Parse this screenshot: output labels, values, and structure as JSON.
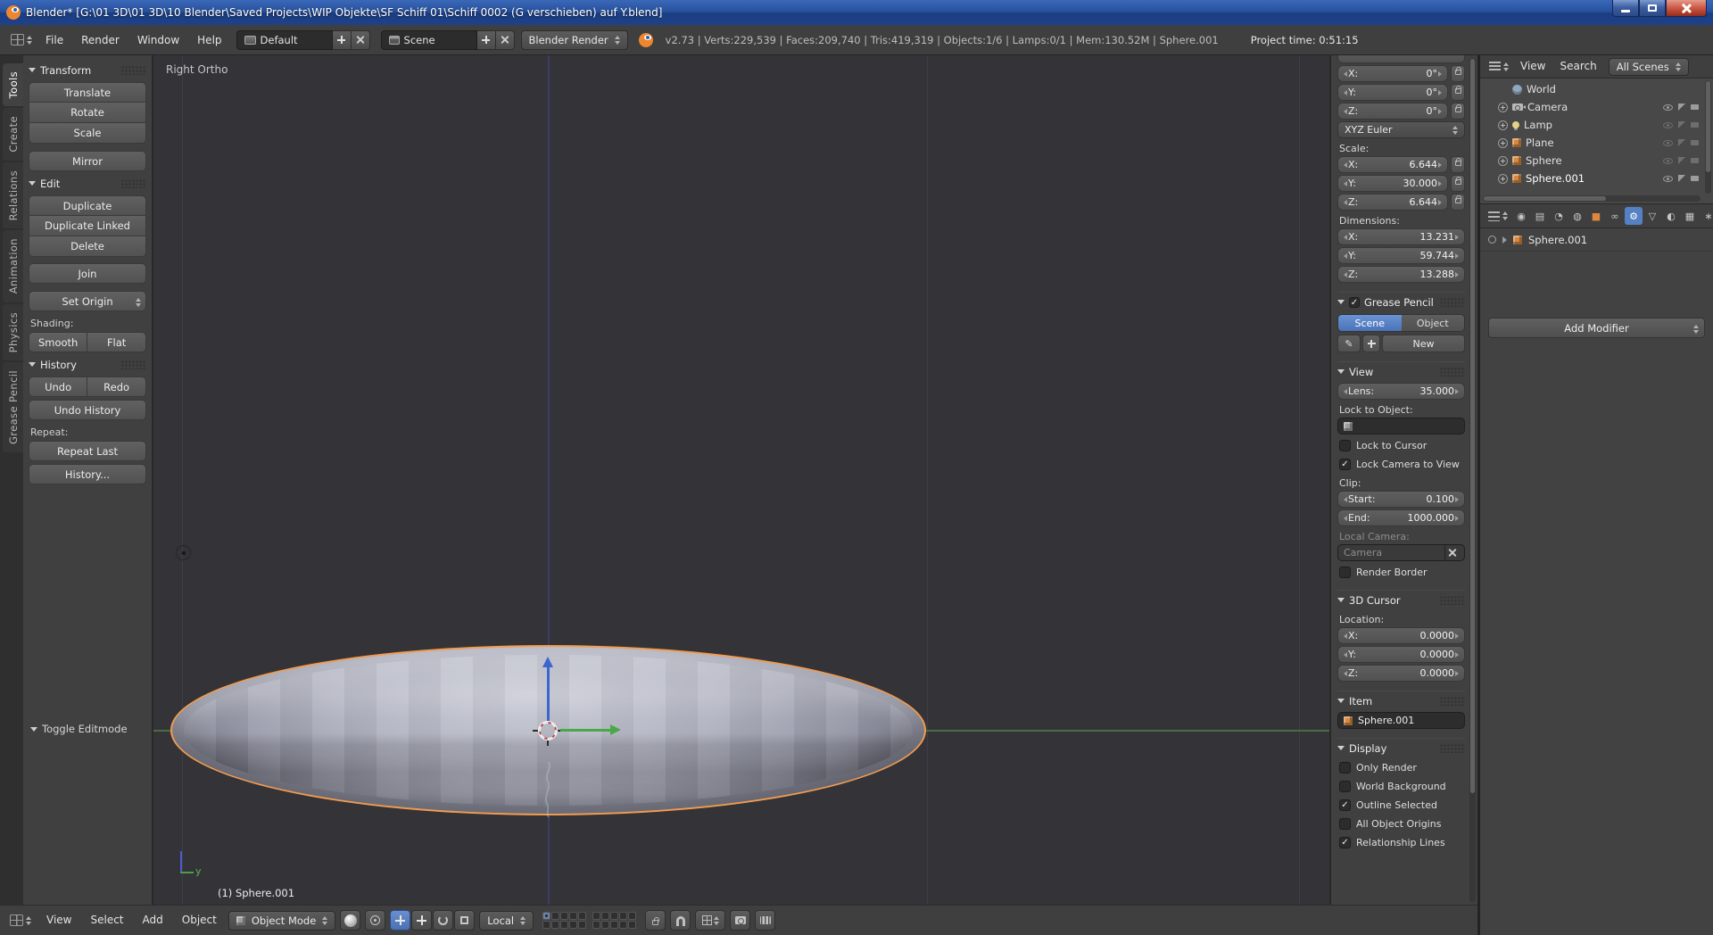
{
  "titlebar": {
    "title": "Blender* [G:\\01 3D\\01 3D\\10 Blender\\Saved Projects\\WIP Objekte\\SF Schiff 01\\Schiff 0002 (G verschieben) auf Y.blend]"
  },
  "topbar": {
    "menus": [
      "File",
      "Render",
      "Window",
      "Help"
    ],
    "layout": "Default",
    "scene": "Scene",
    "engine": "Blender Render",
    "stats": "v2.73 | Verts:229,539 | Faces:209,740 | Tris:419,319 | Objects:1/6 | Lamps:0/1 | Mem:130.52M | Sphere.001",
    "project_time": "Project time: 0:51:15"
  },
  "toolshelf": {
    "tabs": [
      "Tools",
      "Create",
      "Relations",
      "Animation",
      "Physics",
      "Grease Pencil"
    ],
    "transform": {
      "title": "Transform",
      "translate": "Translate",
      "rotate": "Rotate",
      "scale": "Scale",
      "mirror": "Mirror"
    },
    "edit": {
      "title": "Edit",
      "duplicate": "Duplicate",
      "duplicate_linked": "Duplicate Linked",
      "delete": "Delete",
      "join": "Join",
      "set_origin": "Set Origin",
      "shading_label": "Shading:",
      "smooth": "Smooth",
      "flat": "Flat"
    },
    "history": {
      "title": "History",
      "undo": "Undo",
      "redo": "Redo",
      "undo_history": "Undo History",
      "repeat_label": "Repeat:",
      "repeat_last": "Repeat Last",
      "history_item": "History..."
    },
    "redo_panel": "Toggle Editmode"
  },
  "viewport": {
    "view_label": "Right Ortho",
    "object_label": "(1) Sphere.001",
    "axis_y": "y",
    "header": {
      "menus": [
        "View",
        "Select",
        "Add",
        "Object"
      ],
      "mode": "Object Mode",
      "orientation": "Local"
    }
  },
  "npanel": {
    "rotation": {
      "x_label": "X:",
      "x_value": "0°",
      "y_label": "Y:",
      "y_value": "0°",
      "z_label": "Z:",
      "z_value": "0°",
      "mode": "XYZ Euler"
    },
    "scale": {
      "label": "Scale:",
      "x_label": "X:",
      "x_value": "6.644",
      "y_label": "Y:",
      "y_value": "30.000",
      "z_label": "Z:",
      "z_value": "6.644"
    },
    "dimensions": {
      "label": "Dimensions:",
      "x_label": "X:",
      "x_value": "13.231",
      "y_label": "Y:",
      "y_value": "59.744",
      "z_label": "Z:",
      "z_value": "13.288"
    },
    "grease_pencil": {
      "title": "Grease Pencil",
      "scene": "Scene",
      "object": "Object",
      "new_btn": "New"
    },
    "view": {
      "title": "View",
      "lens_label": "Lens:",
      "lens_value": "35.000",
      "lock_to_object": "Lock to Object:",
      "lock_to_cursor": "Lock to Cursor",
      "lock_camera_to_view": "Lock Camera to View",
      "lock_camera_mark": "✓",
      "clip_label": "Clip:",
      "start_label": "Start:",
      "start_value": "0.100",
      "end_label": "End:",
      "end_value": "1000.000",
      "local_camera_label": "Local Camera:",
      "camera_value": "Camera",
      "render_border": "Render Border"
    },
    "cursor": {
      "title": "3D Cursor",
      "location_label": "Location:",
      "x_label": "X:",
      "x_value": "0.0000",
      "y_label": "Y:",
      "y_value": "0.0000",
      "z_label": "Z:",
      "z_value": "0.0000"
    },
    "item": {
      "title": "Item",
      "name": "Sphere.001"
    },
    "display": {
      "title": "Display",
      "options": [
        {
          "label": "Only Render",
          "mark": ""
        },
        {
          "label": "World Background",
          "mark": ""
        },
        {
          "label": "Outline Selected",
          "mark": "✓"
        },
        {
          "label": "All Object Origins",
          "mark": ""
        },
        {
          "label": "Relationship Lines",
          "mark": "✓"
        }
      ]
    }
  },
  "outliner": {
    "view_menu": "View",
    "search_menu": "Search",
    "display_mode": "All Scenes",
    "items": [
      {
        "name": "World",
        "type": "world"
      },
      {
        "name": "Camera",
        "type": "camera"
      },
      {
        "name": "Lamp",
        "type": "lamp"
      },
      {
        "name": "Plane",
        "type": "mesh"
      },
      {
        "name": "Sphere",
        "type": "mesh"
      },
      {
        "name": "Sphere.001",
        "type": "mesh"
      }
    ]
  },
  "properties": {
    "tabs": [
      {
        "name": "render",
        "glyph": "◉"
      },
      {
        "name": "render-layers",
        "glyph": "▤"
      },
      {
        "name": "scene",
        "glyph": "◔"
      },
      {
        "name": "world",
        "glyph": "◍"
      },
      {
        "name": "object",
        "glyph": "■"
      },
      {
        "name": "constraints",
        "glyph": "∞"
      },
      {
        "name": "modifiers",
        "glyph": "⚙"
      },
      {
        "name": "object-data",
        "glyph": "▽"
      },
      {
        "name": "material",
        "glyph": "◐"
      },
      {
        "name": "texture",
        "glyph": "▦"
      },
      {
        "name": "particles",
        "glyph": "∗"
      },
      {
        "name": "physics",
        "glyph": "◯"
      }
    ],
    "breadcrumb_name": "Sphere.001",
    "add_modifier": "Add Modifier"
  },
  "colors": {
    "accent_blue": "#5680c2",
    "selection_orange": "#f29b4e",
    "axis_y_green": "#4c6b44",
    "axis_z_blue": "#3c3c68"
  }
}
